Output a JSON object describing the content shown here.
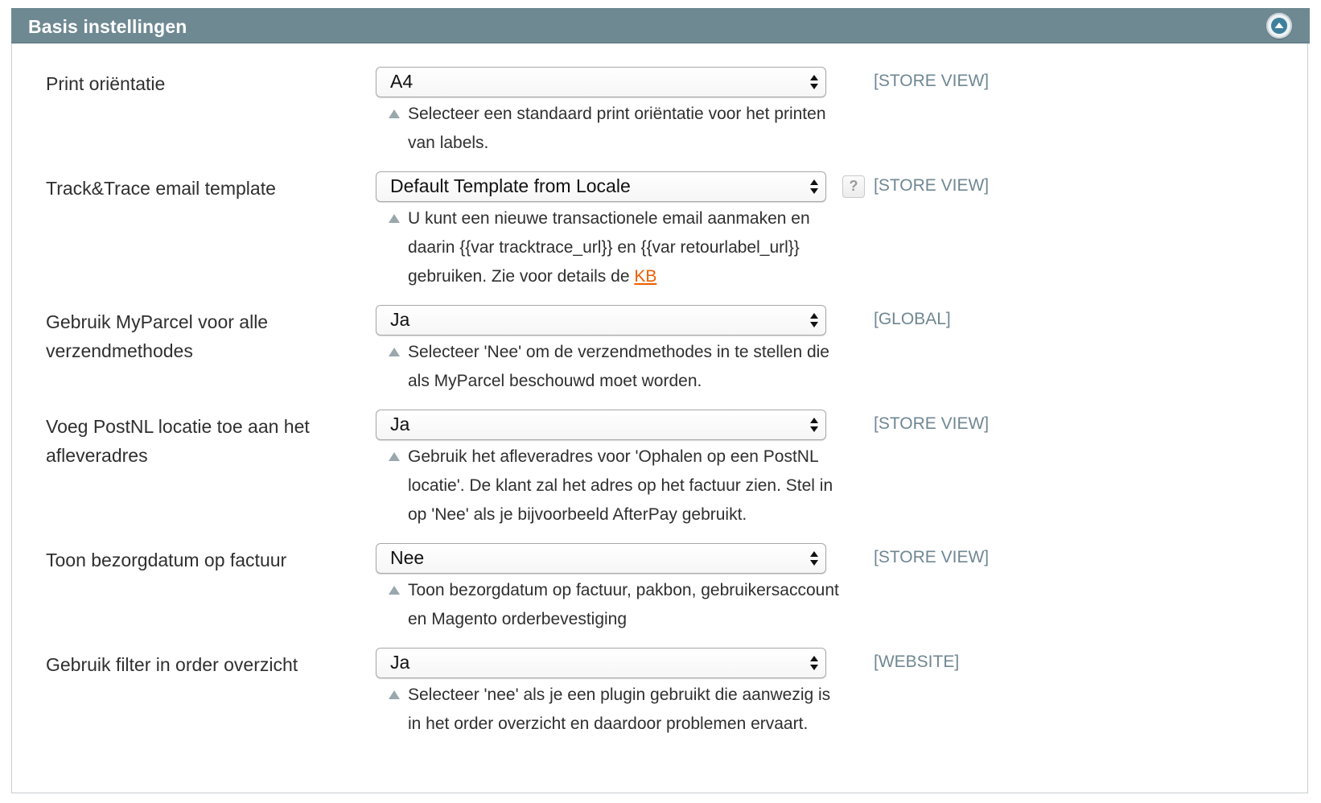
{
  "section": {
    "title": "Basis instellingen",
    "collapse_icon": "chevron-up-icon"
  },
  "fields": [
    {
      "label": "Print oriëntatie",
      "value": "A4",
      "scope": "[STORE VIEW]",
      "note": "Selecteer een standaard print oriëntatie voor het printen van labels."
    },
    {
      "label": "Track&Trace email template",
      "value": "Default Template from Locale",
      "scope": "[STORE VIEW]",
      "help_label": "?",
      "note_prefix": "U kunt een nieuwe transactionele email aanmaken en daarin {{var tracktrace_url}} en {{var retourlabel_url}} gebruiken. Zie voor details de ",
      "note_link": "KB"
    },
    {
      "label": "Gebruik MyParcel voor alle verzendmethodes",
      "value": "Ja",
      "scope": "[GLOBAL]",
      "note": "Selecteer 'Nee' om de verzendmethodes in te stellen die als MyParcel beschouwd moet worden."
    },
    {
      "label": "Voeg PostNL locatie toe aan het afleveradres",
      "value": "Ja",
      "scope": "[STORE VIEW]",
      "note": "Gebruik het afleveradres voor 'Ophalen op een PostNL locatie'. De klant zal het adres op het factuur zien. Stel in op 'Nee' als je bijvoorbeeld AfterPay gebruikt."
    },
    {
      "label": "Toon bezorgdatum op factuur",
      "value": "Nee",
      "scope": "[STORE VIEW]",
      "note": "Toon bezorgdatum op factuur, pakbon, gebruikersaccount en Magento orderbevestiging"
    },
    {
      "label": "Gebruik filter in order overzicht",
      "value": "Ja",
      "scope": "[WEBSITE]",
      "note": "Selecteer 'nee' als je een plugin gebruikt die aanwezig is in het order overzicht en daardoor problemen ervaart."
    }
  ],
  "colors": {
    "header_bg": "#6f8992",
    "scope_text": "#6f8792",
    "link": "#eb5e00"
  }
}
